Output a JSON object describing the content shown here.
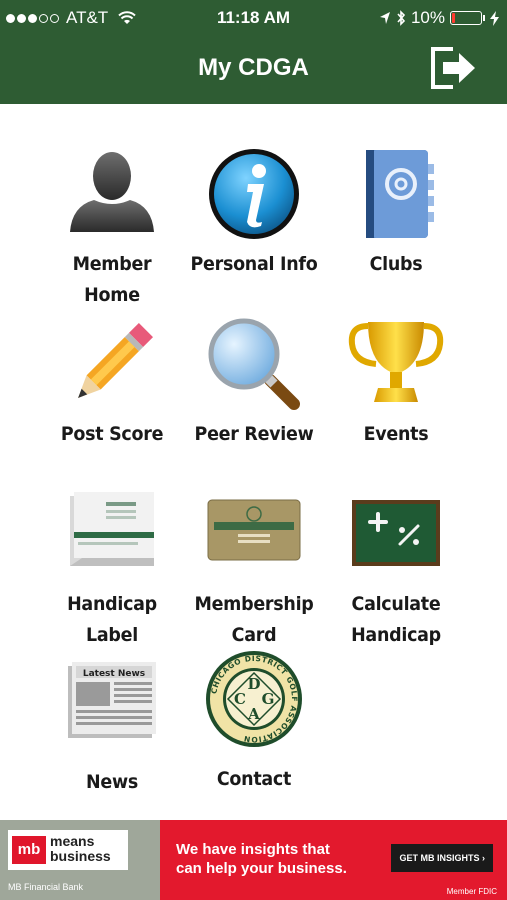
{
  "status_bar": {
    "carrier": "AT&T",
    "time": "11:18 AM",
    "battery": "10%",
    "battery_level": 0.1,
    "signal_bars_filled": 3,
    "signal_bars_total": 5,
    "icons": [
      "wifi-icon",
      "location-icon",
      "bluetooth-icon",
      "battery-icon",
      "charging-icon"
    ]
  },
  "nav": {
    "title": "My CDGA",
    "logout_icon": "logout-icon"
  },
  "tiles": [
    {
      "label": "Member Home",
      "icon": "member-silhouette-icon"
    },
    {
      "label": "Personal Info",
      "icon": "info-icon"
    },
    {
      "label": "Clubs",
      "icon": "address-book-icon"
    },
    {
      "label": "Post Score",
      "icon": "pencil-icon"
    },
    {
      "label": "Peer Review",
      "icon": "magnifier-icon"
    },
    {
      "label": "Events",
      "icon": "trophy-icon"
    },
    {
      "label": "Handicap\nLabel",
      "icon": "handicap-label-icon"
    },
    {
      "label": "Membership\nCard",
      "icon": "membership-card-icon"
    },
    {
      "label": "Calculate\nHandicap",
      "icon": "chalkboard-icon"
    },
    {
      "label": "News",
      "icon": "newspaper-icon"
    },
    {
      "label": "Contact",
      "icon": "cdga-logo-icon"
    }
  ],
  "icon_text": {
    "newspaper_heading": "Latest News",
    "logo_ring": "CHICAGO DISTRICT GOLF ASSOCIATION",
    "logo_letters": [
      "C",
      "D",
      "G",
      "A"
    ]
  },
  "ad": {
    "logo_mark": "mb",
    "logo_text_1": "means",
    "logo_text_2": "business",
    "bank_name": "MB Financial Bank",
    "headline_1": "We have insights that",
    "headline_2": "can help your business.",
    "cta": "GET MB INSIGHTS",
    "fdic": "Member FDIC"
  },
  "colors": {
    "header_green": "#2e5c33",
    "ad_red": "#e3192d",
    "battery_red": "#ff3b30"
  }
}
